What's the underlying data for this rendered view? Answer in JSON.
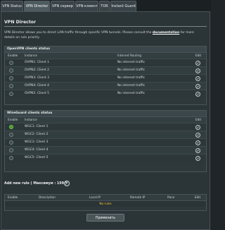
{
  "tabs": [
    {
      "label": "VPN Status",
      "active": false
    },
    {
      "label": "VPN Director",
      "active": true
    },
    {
      "label": "VPN сервер",
      "active": false
    },
    {
      "label": "VPN-клиент",
      "active": false
    },
    {
      "label": "TOR",
      "active": false
    },
    {
      "label": "Instant Guard",
      "active": false
    }
  ],
  "page_title": "VPN Director",
  "description": {
    "text": "VPN Director allows you to direct LAN traffic through specific VPN tunnels. Please consult the",
    "link": "documentation",
    "text_after": "for more details on rule priority."
  },
  "openvpn": {
    "title": "OpenVPN clients status",
    "headers": {
      "enable": "Enable",
      "instance": "Instance",
      "routing": "Internet Routing",
      "edit": "Edit"
    },
    "rows": [
      {
        "instance": "OVPN1: Client 1",
        "routing": "No internet traffic",
        "enabled": false
      },
      {
        "instance": "OVPN2: Client 2",
        "routing": "No internet traffic",
        "enabled": false
      },
      {
        "instance": "OVPN3: Client 3",
        "routing": "No internet traffic",
        "enabled": false
      },
      {
        "instance": "OVPN4: Client 4",
        "routing": "No internet traffic",
        "enabled": false
      },
      {
        "instance": "OVPN5: Client 5",
        "routing": "No internet traffic",
        "enabled": false
      }
    ]
  },
  "wireguard": {
    "title": "WireGuard clients status",
    "headers": {
      "enable": "Enable",
      "instance": "Instance",
      "edit": "Edit"
    },
    "rows": [
      {
        "instance": "WGC1: Client 1",
        "enabled": true
      },
      {
        "instance": "WGC2: Client 2",
        "enabled": false
      },
      {
        "instance": "WGC3: Client 3",
        "enabled": false
      },
      {
        "instance": "WGC4: Client 4",
        "enabled": false
      },
      {
        "instance": "WGC5: Client 5",
        "enabled": false
      }
    ]
  },
  "add_rule": {
    "label": "Add new rule ( Максимум : 199 )",
    "button": "+"
  },
  "rules_table": {
    "headers": {
      "enable": "Enable",
      "description": "Description",
      "local_ip": "Local IP",
      "remote_ip": "Remote IP",
      "iface": "Iface",
      "edit": "Edit"
    },
    "empty_text": "No rules"
  },
  "apply_button": "Применить",
  "colors": {
    "background": "#202628",
    "panel": "#2b3437",
    "enabled_toggle": "#4a9a2e",
    "no_rules_text": "#f0c030"
  }
}
